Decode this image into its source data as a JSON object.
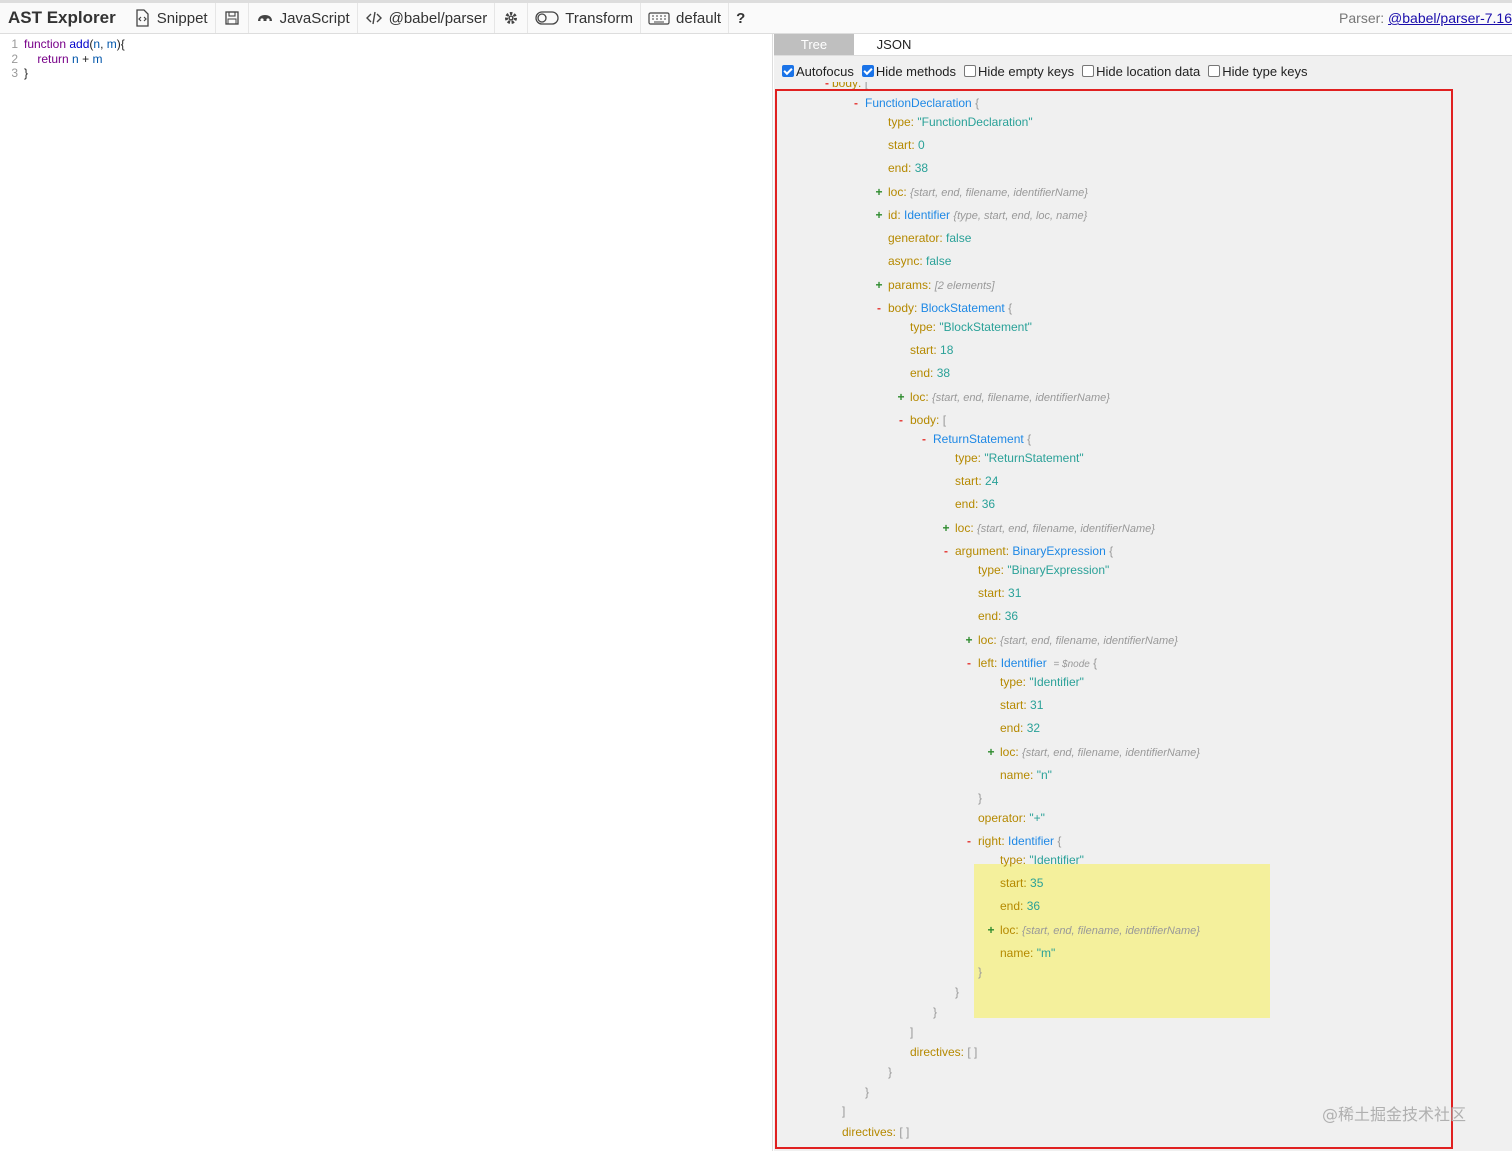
{
  "toolbar": {
    "brand": "AST Explorer",
    "snippet": "Snippet",
    "language": "JavaScript",
    "parser": "@babel/parser",
    "transform": "Transform",
    "keymap": "default",
    "help": "?",
    "parser_label": "Parser:",
    "parser_version": "@babel/parser-7.16"
  },
  "editor": {
    "line_numbers": [
      "1",
      "2",
      "3"
    ]
  },
  "tabs": [
    {
      "label": "Tree"
    },
    {
      "label": "JSON"
    }
  ],
  "options": [
    {
      "label": "Autofocus",
      "checked": true
    },
    {
      "label": "Hide methods",
      "checked": true
    },
    {
      "label": "Hide empty keys",
      "checked": false
    },
    {
      "label": "Hide location data",
      "checked": false
    },
    {
      "label": "Hide type keys",
      "checked": false
    }
  ],
  "tree": {
    "top_key": "body:",
    "top_bracket": "[",
    "fd": {
      "type_name": "FunctionDeclaration",
      "type_val": "\"FunctionDeclaration\"",
      "start": "0",
      "end": "38",
      "loc_sum": "{start, end, filename, identifierName}",
      "id_type": "Identifier",
      "id_sum": "{type, start, end, loc, name}",
      "generator": "false",
      "async": "false",
      "params_sum": "[2 elements]"
    },
    "bs": {
      "type_name": "BlockStatement",
      "type_val": "\"BlockStatement\"",
      "start": "18",
      "end": "38",
      "loc_sum": "{start, end, filename, identifierName}"
    },
    "rs": {
      "type_name": "ReturnStatement",
      "type_val": "\"ReturnStatement\"",
      "start": "24",
      "end": "36",
      "loc_sum": "{start, end, filename, identifierName}"
    },
    "be": {
      "type_name": "BinaryExpression",
      "type_val": "\"BinaryExpression\"",
      "start": "31",
      "end": "36",
      "loc_sum": "{start, end, filename, identifierName}",
      "operator": "\"+\""
    },
    "left": {
      "type_name": "Identifier",
      "node_ref": "= $node",
      "type_val": "\"Identifier\"",
      "start": "31",
      "end": "32",
      "loc_sum": "{start, end, filename, identifierName}",
      "name": "\"n\""
    },
    "right": {
      "type_name": "Identifier",
      "type_val": "\"Identifier\"",
      "start": "35",
      "end": "36",
      "loc_sum": "{start, end, filename, identifierName}",
      "name": "\"m\""
    },
    "empty_array": "[ ]"
  },
  "watermark": "@稀土掘金技术社区"
}
